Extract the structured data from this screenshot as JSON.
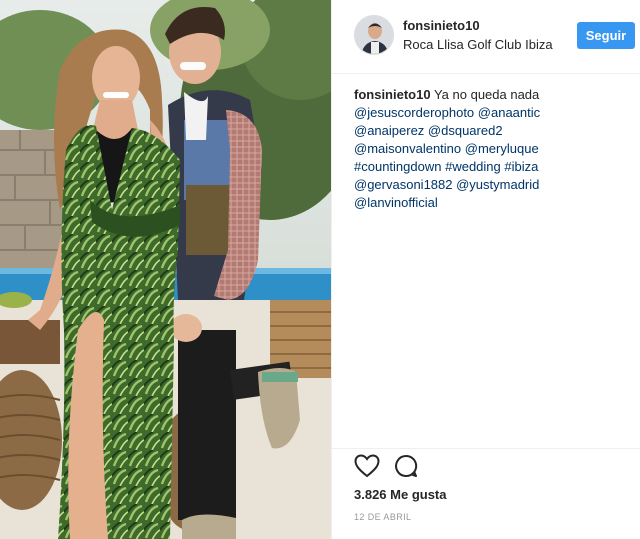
{
  "post": {
    "author": "fonsinieto10",
    "location": "Roca Llisa Golf Club Ibiza",
    "follow_label": "Seguir",
    "caption_user": "fonsinieto10",
    "caption_text": "Ya no queda nada",
    "caption_tokens": [
      "@jesuscorderophoto",
      "@anaantic",
      "@anaiperez",
      "@dsquared2",
      "@maisonvalentino",
      "@meryluque",
      "#countingdown",
      "#wedding",
      "#ibiza",
      "@gervasoni1882",
      "@yustymadrid",
      "@lanvinofficial"
    ],
    "likes": "3.826 Me gusta",
    "date": "12 DE ABRIL"
  },
  "icons": {
    "like": "heart-icon",
    "comment": "comment-icon"
  },
  "colors": {
    "accent": "#3897f0",
    "link": "#003569",
    "text": "#262626",
    "muted": "#999999",
    "divider": "#efefef"
  }
}
